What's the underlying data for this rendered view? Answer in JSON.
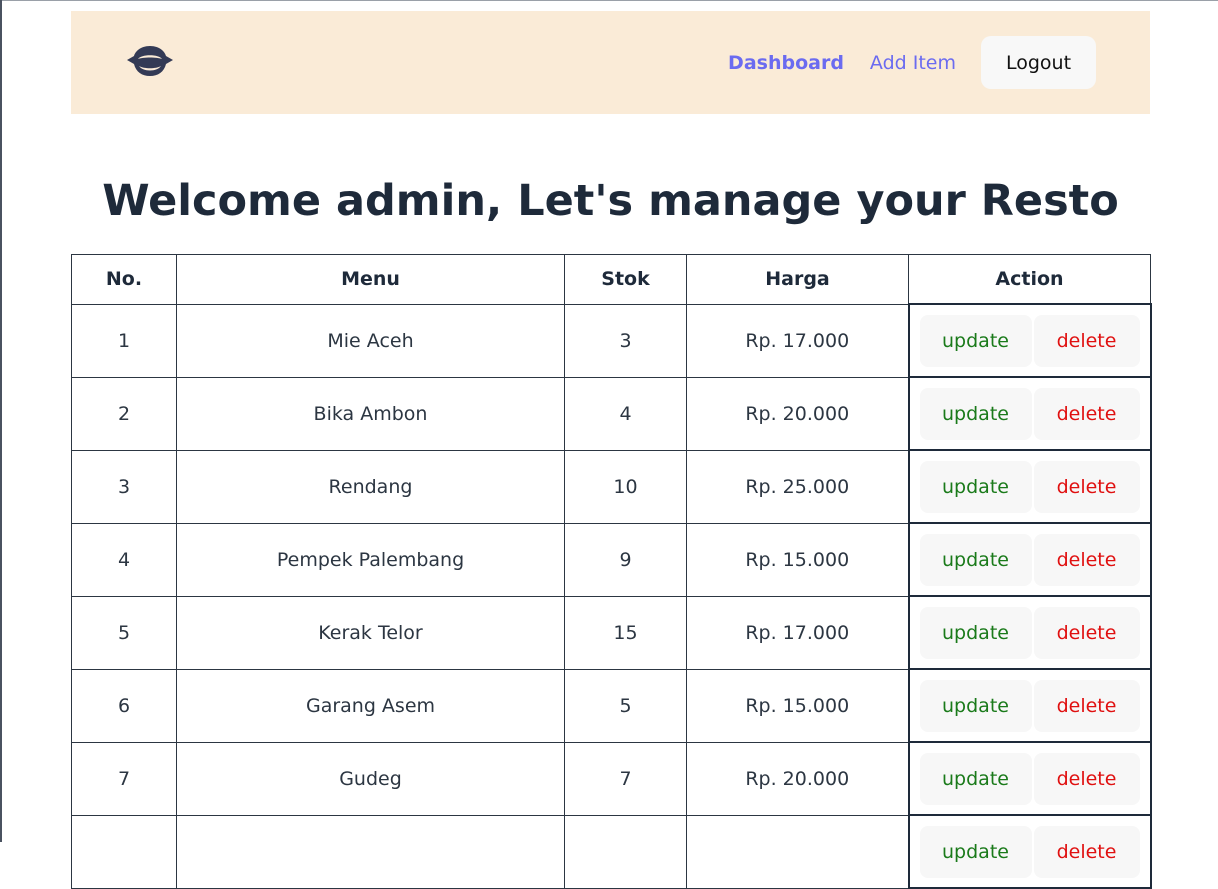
{
  "nav": {
    "logo_icon": "ufo-bowl-icon",
    "links": [
      "Dashboard",
      "Add Item"
    ],
    "logout_label": "Logout",
    "link_color": "#6b6bf0",
    "background": "#faebd7"
  },
  "page": {
    "title": "Welcome admin, Let's manage your Resto"
  },
  "table": {
    "headers": [
      "No.",
      "Menu",
      "Stok",
      "Harga",
      "Action"
    ],
    "update_label": "update",
    "delete_label": "delete",
    "update_color": "#1a7a1a",
    "delete_color": "#e01010",
    "rows": [
      {
        "no": "1",
        "menu": "Mie Aceh",
        "stok": "3",
        "harga": "Rp. 17.000"
      },
      {
        "no": "2",
        "menu": "Bika Ambon",
        "stok": "4",
        "harga": "Rp. 20.000"
      },
      {
        "no": "3",
        "menu": "Rendang",
        "stok": "10",
        "harga": "Rp. 25.000"
      },
      {
        "no": "4",
        "menu": "Pempek Palembang",
        "stok": "9",
        "harga": "Rp. 15.000"
      },
      {
        "no": "5",
        "menu": "Kerak Telor",
        "stok": "15",
        "harga": "Rp. 17.000"
      },
      {
        "no": "6",
        "menu": "Garang Asem",
        "stok": "5",
        "harga": "Rp. 15.000"
      },
      {
        "no": "7",
        "menu": "Gudeg",
        "stok": "7",
        "harga": "Rp. 20.000"
      },
      {
        "no": "",
        "menu": "",
        "stok": "",
        "harga": ""
      }
    ]
  }
}
